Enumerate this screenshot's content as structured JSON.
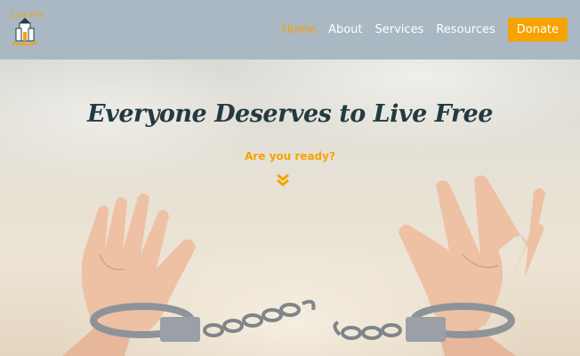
{
  "header": {
    "logo": {
      "name": "site-logo",
      "icon": "castle-logo-icon",
      "text": "Live Free"
    },
    "nav": {
      "items": [
        {
          "label": "Home",
          "active": true
        },
        {
          "label": "About",
          "active": false
        },
        {
          "label": "Services",
          "active": false
        },
        {
          "label": "Resources",
          "active": false
        }
      ],
      "donate_label": "Donate"
    }
  },
  "hero": {
    "headline": "Everyone Deserves to Live Free",
    "subtitle": "Are you ready?",
    "scroll_icon": "double-chevron-down-icon",
    "image": "raised-hands-breaking-handcuffs"
  },
  "colors": {
    "header_bg": "#a9b8c3",
    "accent": "#f5a300",
    "headline": "#233a40"
  }
}
